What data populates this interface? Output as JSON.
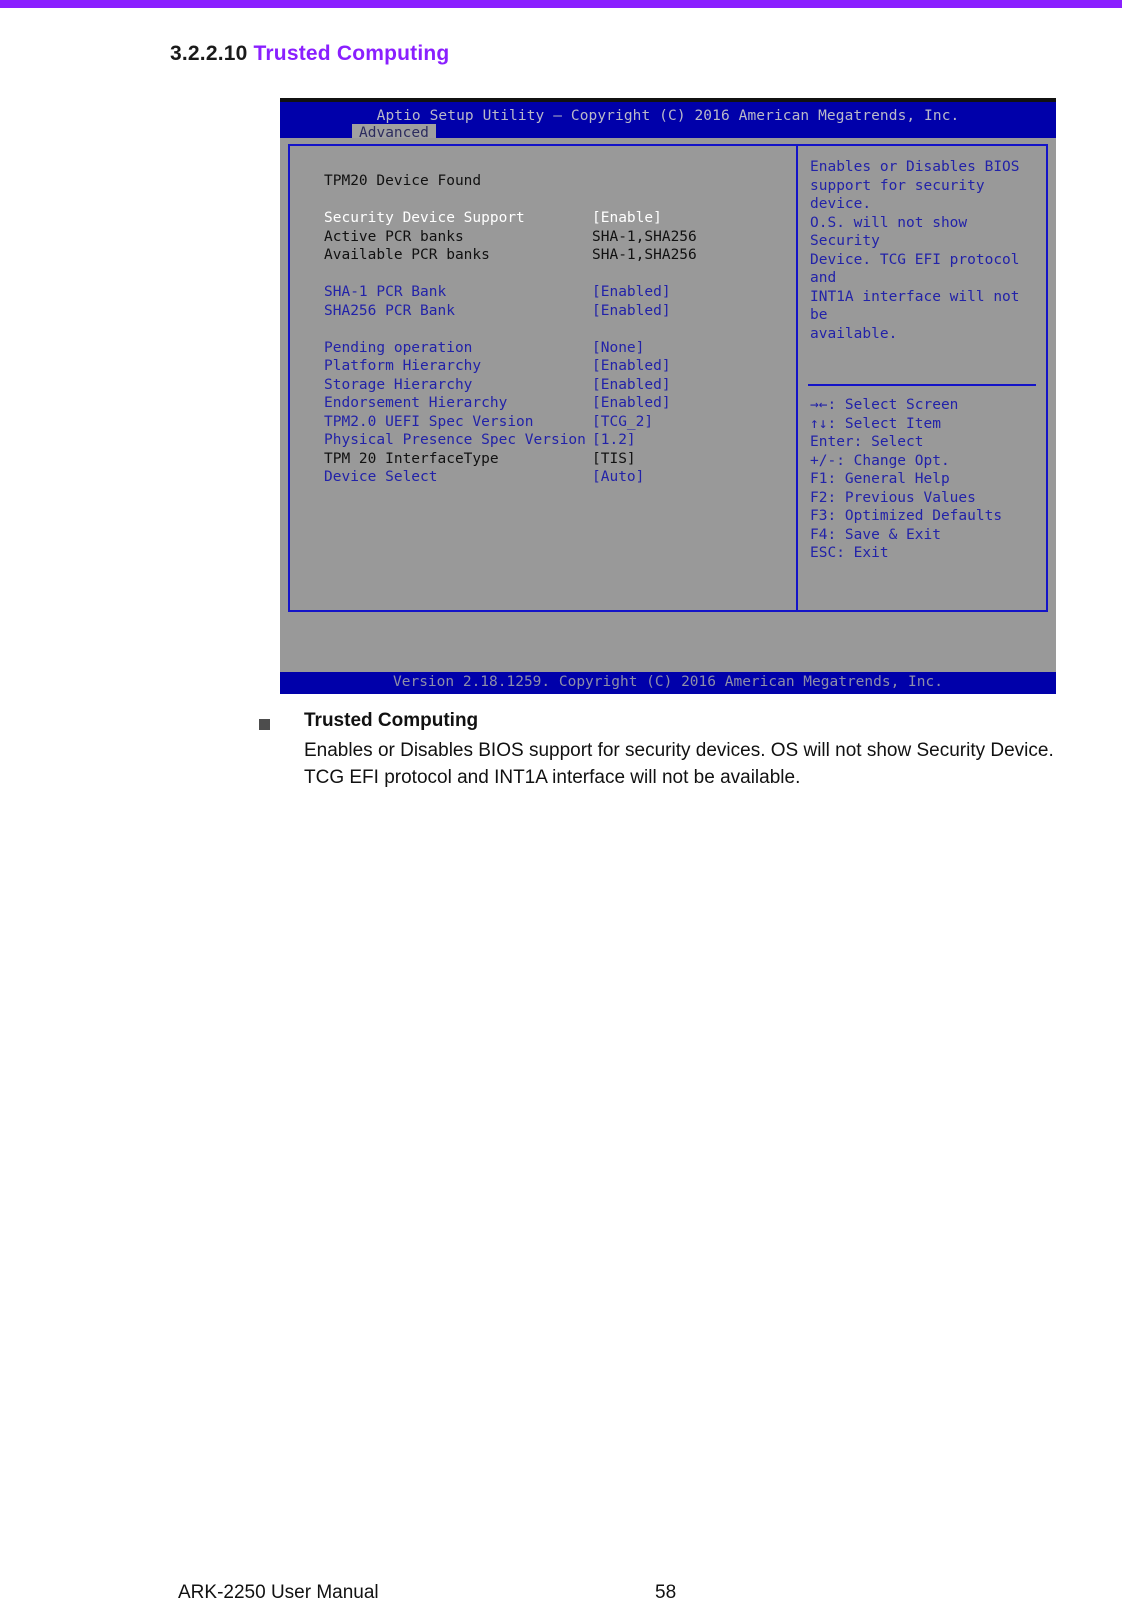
{
  "accent_color": "#8a1fff",
  "heading": {
    "number": "3.2.2.10",
    "title": "Trusted Computing"
  },
  "bios": {
    "title": "Aptio Setup Utility – Copyright (C) 2016 American Megatrends, Inc.",
    "active_tab": "Advanced",
    "status_line": "TPM20 Device Found",
    "items": [
      {
        "label": "Security Device Support",
        "value": "[Enable]",
        "label_color": "white",
        "value_color": "white",
        "selected": true
      },
      {
        "label": "Active PCR banks",
        "value": "SHA-1,SHA256",
        "label_color": "black",
        "value_color": "black",
        "selected": false
      },
      {
        "label": "Available PCR banks",
        "value": "SHA-1,SHA256",
        "label_color": "black",
        "value_color": "black",
        "selected": false
      },
      {
        "label": "",
        "value": "",
        "label_color": "black",
        "value_color": "black",
        "selected": false
      },
      {
        "label": "SHA-1 PCR Bank",
        "value": "[Enabled]",
        "label_color": "blue",
        "value_color": "blue",
        "selected": false
      },
      {
        "label": "SHA256 PCR Bank",
        "value": "[Enabled]",
        "label_color": "blue",
        "value_color": "blue",
        "selected": false
      },
      {
        "label": "",
        "value": "",
        "label_color": "black",
        "value_color": "black",
        "selected": false
      },
      {
        "label": "Pending operation",
        "value": "[None]",
        "label_color": "blue",
        "value_color": "blue",
        "selected": false
      },
      {
        "label": "Platform Hierarchy",
        "value": "[Enabled]",
        "label_color": "blue",
        "value_color": "blue",
        "selected": false
      },
      {
        "label": "Storage Hierarchy",
        "value": "[Enabled]",
        "label_color": "blue",
        "value_color": "blue",
        "selected": false
      },
      {
        "label": "Endorsement Hierarchy",
        "value": "[Enabled]",
        "label_color": "blue",
        "value_color": "blue",
        "selected": false
      },
      {
        "label": "TPM2.0 UEFI Spec Version",
        "value": "[TCG_2]",
        "label_color": "blue",
        "value_color": "blue",
        "selected": false
      },
      {
        "label": "Physical Presence Spec Version",
        "value": "[1.2]",
        "label_color": "blue",
        "value_color": "blue",
        "selected": false
      },
      {
        "label": "TPM 20 InterfaceType",
        "value": "[TIS]",
        "label_color": "black",
        "value_color": "black",
        "selected": false
      },
      {
        "label": "Device Select",
        "value": "[Auto]",
        "label_color": "blue",
        "value_color": "blue",
        "selected": false
      }
    ],
    "help_lines": [
      "Enables or Disables BIOS",
      "support for security device.",
      "O.S. will not show Security",
      "Device. TCG EFI protocol and",
      "INT1A interface will not be",
      "available."
    ],
    "key_legend": [
      "→←: Select Screen",
      "↑↓: Select Item",
      "Enter: Select",
      "+/-: Change Opt.",
      "F1: General Help",
      "F2: Previous Values",
      "F3: Optimized Defaults",
      "F4: Save & Exit",
      "ESC: Exit"
    ],
    "footer": "Version 2.18.1259. Copyright (C) 2016 American Megatrends, Inc."
  },
  "bullet": {
    "title": "Trusted Computing",
    "body": "Enables or Disables BIOS support for security devices. OS will not show Security Device. TCG EFI protocol and INT1A interface will not be available."
  },
  "page_footer": {
    "manual": "ARK-2250 User Manual",
    "page_number": "58"
  }
}
